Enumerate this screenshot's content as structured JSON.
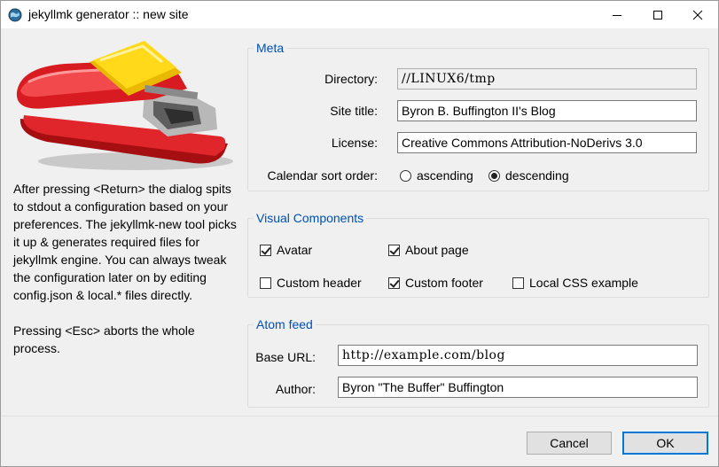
{
  "window": {
    "title": "jekyllmk generator :: new site",
    "controls": [
      "minimize",
      "maximize",
      "close"
    ]
  },
  "description": {
    "paragraph1": "After pressing <Return> the dialog spits to stdout a configuration based on your preferences. The jekyllmk-new tool picks it up & generates required files for jekyllmk engine. You can always tweak the configuration later on by editing config.json & local.* files directly.",
    "paragraph2": "Pressing <Esc> aborts the whole process."
  },
  "meta": {
    "title": "Meta",
    "directory_label": "Directory:",
    "directory_value": "//LINUX6/tmp",
    "site_title_label": "Site title:",
    "site_title_value": "Byron B. Buffington II's Blog",
    "license_label": "License:",
    "license_value": "Creative Commons Attribution-NoDerivs 3.0",
    "sort_label": "Calendar sort order:",
    "sort_options": [
      "ascending",
      "descending"
    ],
    "sort_selected": "descending"
  },
  "visual": {
    "title": "Visual Components",
    "avatar": {
      "label": "Avatar",
      "checked": true
    },
    "about": {
      "label": "About page",
      "checked": true
    },
    "custom_header": {
      "label": "Custom header",
      "checked": false
    },
    "custom_footer": {
      "label": "Custom footer",
      "checked": true
    },
    "local_css": {
      "label": "Local CSS example",
      "checked": false
    }
  },
  "atom": {
    "title": "Atom feed",
    "base_url_label": "Base URL:",
    "base_url_value": "http://example.com/blog",
    "author_label": "Author:",
    "author_value": "Byron \"The Buffer\" Buffington"
  },
  "buttons": {
    "cancel": "Cancel",
    "ok": "OK"
  },
  "colors": {
    "group_title": "#0050b4",
    "default_button_border": "#0078d7",
    "stapler_body": "#d4161a",
    "stapler_cap": "#f5d300"
  }
}
